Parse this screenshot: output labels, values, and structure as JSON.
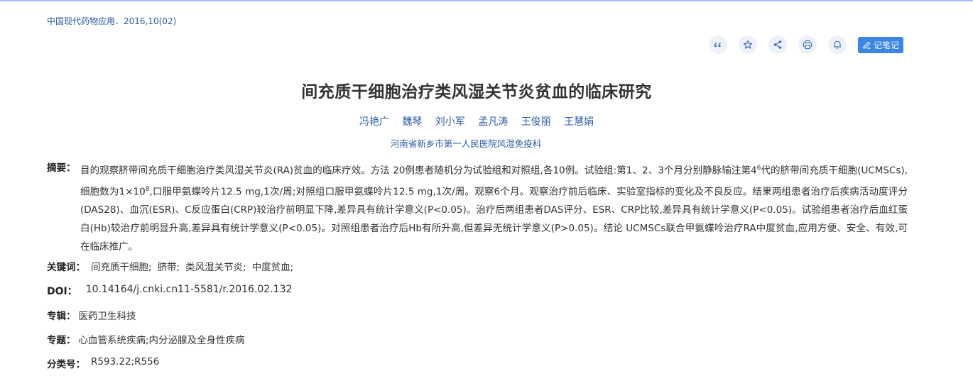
{
  "source": "中国现代药物应用．2016,10(02)",
  "toolbar": {
    "quote_icon": "quote-icon",
    "favorite_icon": "star-icon",
    "share_icon": "share-icon",
    "print_icon": "printer-icon",
    "notify_icon": "bell-icon",
    "note_label": "记笔记"
  },
  "title": "间充质干细胞治疗类风湿关节炎贫血的临床研究",
  "authors": [
    "冯艳广",
    "魏琴",
    "刘小军",
    "孟凡涛",
    "王俊丽",
    "王慧娟"
  ],
  "affiliation": "河南省新乡市第一人民医院风湿免疫科",
  "abstract": {
    "label": "摘要：",
    "text_part1": "目的观察脐带间充质干细胞治疗类风湿关节炎(RA)贫血的临床疗效。方法 20例患者随机分为试验组和对照组,各10例。试验组:第1、2、3个月分别静脉输注第4",
    "sup1": "6",
    "text_part2": "代的脐带间充质干细胞(UCMSCs),细胞数为1×10",
    "sup2": "8",
    "text_part3": ",口服甲氨蝶呤片12.5 mg,1次/周;对照组口服甲氨蝶呤片12.5 mg,1次/周。观察6个月。观察治疗前后临床、实验室指标的变化及不良反应。结果两组患者治疗后疾病活动度评分(DAS28)、血沉(ESR)、C反应蛋白(CRP)较治疗前明显下降,差异具有统计学意义(P<0.05)。治疗后两组患者DAS评分、ESR、CRP比较,差异具有统计学意义(P<0.05)。试验组患者治疗后血红蛋白(Hb)较治疗前明显升高,差异具有统计学意义(P<0.05)。对照组患者治疗后Hb有所升高,但差异无统计学意义(P>0.05)。结论 UCMSCs联合甲氨蝶呤治疗RA中度贫血,应用方便、安全、有效,可在临床推广。"
  },
  "keywords": {
    "label": "关键词：",
    "items": [
      "间充质干细胞;",
      "脐带;",
      "类风湿关节炎;",
      "中度贫血;"
    ]
  },
  "doi": {
    "label": "DOI：",
    "value": "10.14164/j.cnki.cn11-5581/r.2016.02.132"
  },
  "album": {
    "label": "专辑：",
    "value": "医药卫生科技"
  },
  "topic": {
    "label": "专题：",
    "value": "心血管系统疾病;内分泌腺及全身性疾病"
  },
  "clc": {
    "label": "分类号：",
    "value": "R593.22;R556"
  },
  "colors": {
    "link": "#2b5aa6",
    "accent": "#3a86e0",
    "icon_bg": "#eef1f8"
  }
}
